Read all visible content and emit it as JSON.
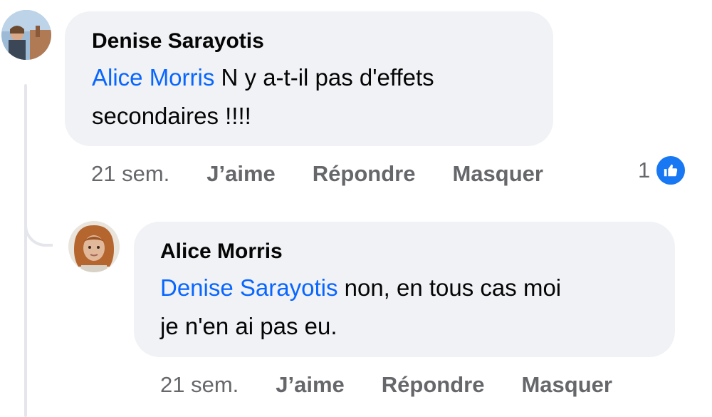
{
  "comments": [
    {
      "author": "Denise Sarayotis",
      "mention": "Alice Morris",
      "text_line1": " N y a-t-il pas d'effets",
      "text_line2": "secondaires !!!!",
      "time": "21 sem.",
      "like_label": "J’aime",
      "reply_label": "Répondre",
      "hide_label": "Masquer",
      "reaction_count": "1",
      "reaction_icon": "thumbs-up-icon",
      "reaction_color": "#1877f2"
    },
    {
      "author": "Alice Morris",
      "mention": "Denise Sarayotis",
      "text_line1": " non, en tous cas moi",
      "text_line2": "je n'en ai pas eu.",
      "time": "21 sem.",
      "like_label": "J’aime",
      "reply_label": "Répondre",
      "hide_label": "Masquer"
    }
  ],
  "colors": {
    "bubble": "#f0f2f5",
    "mention": "#0866ff",
    "meta": "#65676b"
  }
}
